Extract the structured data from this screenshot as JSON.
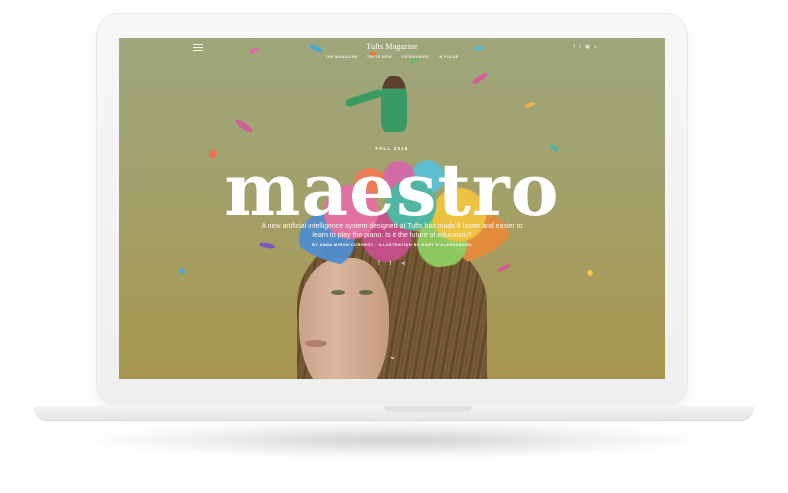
{
  "nav": {
    "brand": "Tufts Magazine",
    "links": [
      "THE MAGAZINE",
      "TUFTS NOW",
      "CATEGORIES",
      "IN FOCUS"
    ],
    "menu_icon": "hamburger-menu-icon",
    "social_icons": [
      "facebook-icon",
      "twitter-icon",
      "instagram-icon",
      "search-icon"
    ]
  },
  "hero": {
    "season": "FALL 2016",
    "headline": "maestro",
    "subhead": "A new artificial intelligence system designed at Tufts has made it faster and easier to learn to play the piano. Is it the future of education?",
    "byline": "BY ANNA MIRON·CORGEOT · ILLUSTRATION BY GARY D'ALESSANDRO",
    "share_icons": [
      "facebook-icon",
      "twitter-icon",
      "share-icon"
    ],
    "scroll_icon": "chevron-down-icon"
  },
  "colors": {
    "screen_top": "#9ea67b",
    "screen_bottom": "#a89650",
    "text": "#ffffff"
  }
}
